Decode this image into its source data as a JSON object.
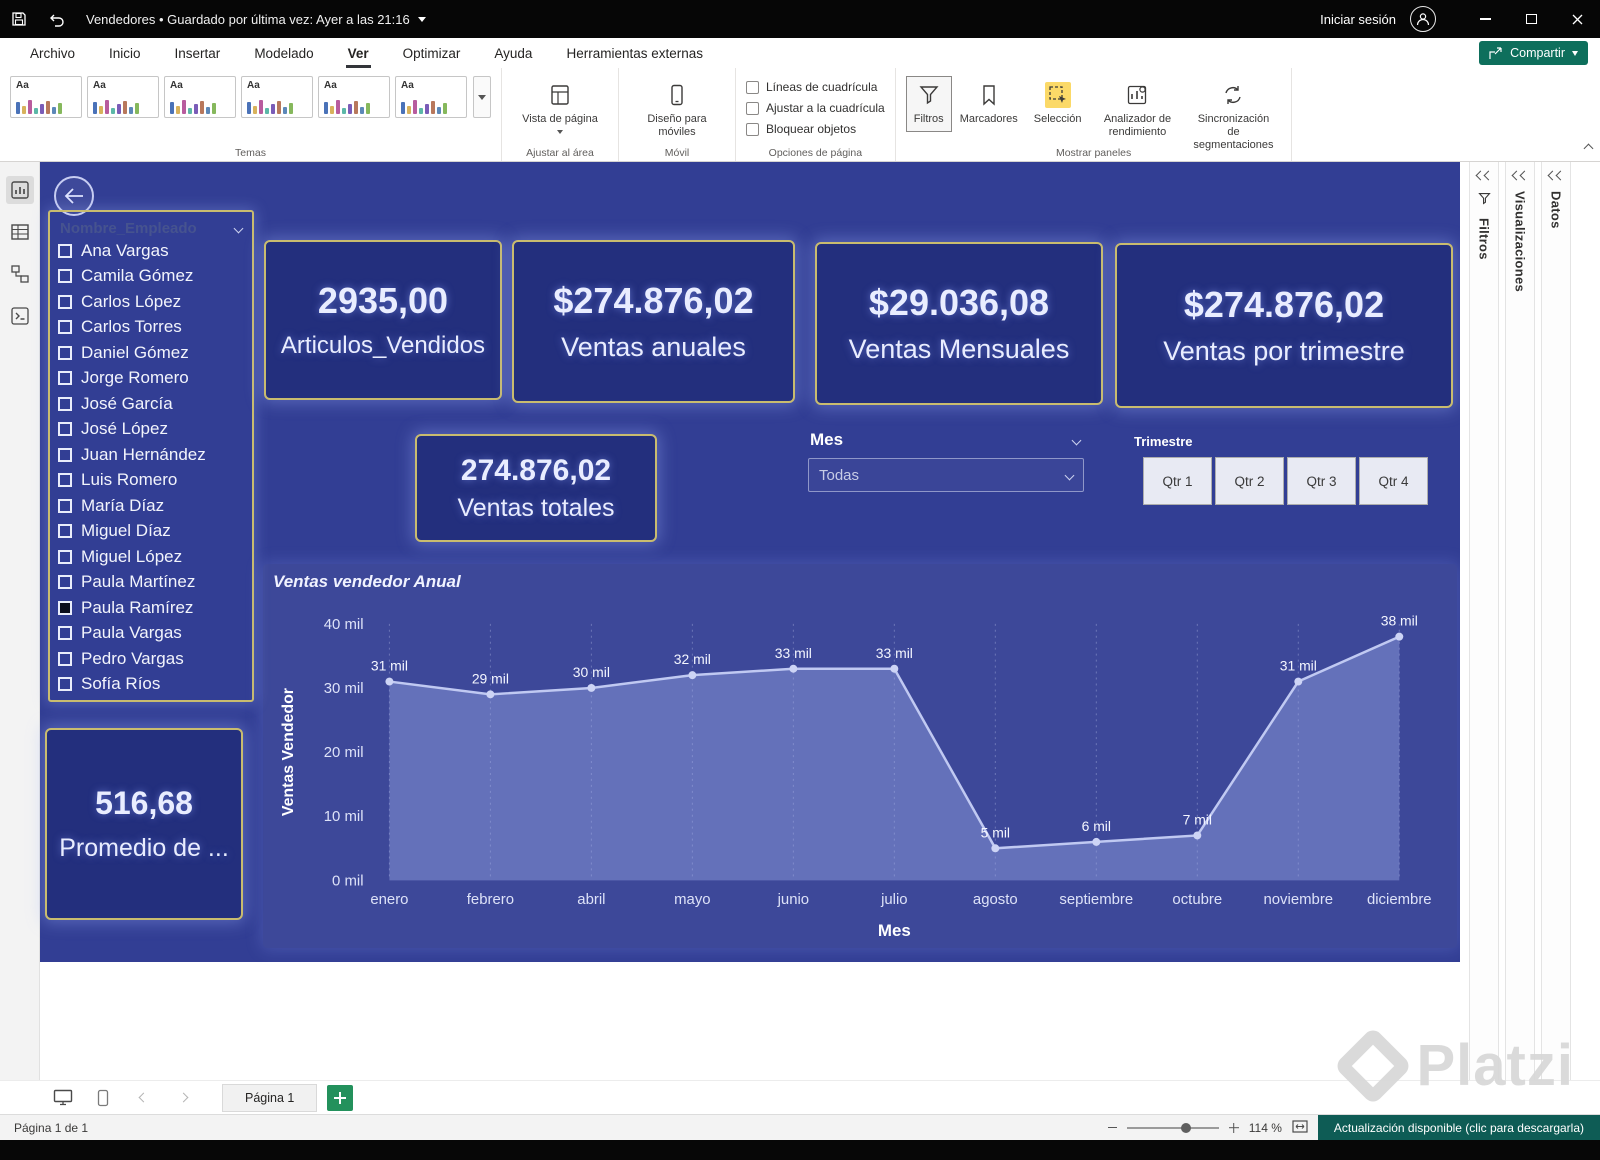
{
  "titlebar": {
    "title": "Vendedores • Guardado por última vez: Ayer a las 21:16",
    "sign_in": "Iniciar sesión"
  },
  "menubar": {
    "items": [
      "Archivo",
      "Inicio",
      "Insertar",
      "Modelado",
      "Ver",
      "Optimizar",
      "Ayuda",
      "Herramientas externas"
    ],
    "active": "Ver",
    "share_label": "Compartir"
  },
  "ribbon": {
    "themes": {
      "group_label": "Temas",
      "items": [
        {
          "label": "Aa"
        },
        {
          "label": "Aa"
        },
        {
          "label": "Aa"
        },
        {
          "label": "Aa"
        },
        {
          "label": "Aa"
        },
        {
          "label": "Aa"
        }
      ]
    },
    "page_view": {
      "label": "Vista de página",
      "group_label": "Ajustar al área"
    },
    "mobile": {
      "label": "Diseño para móviles",
      "group_label": "Móvil"
    },
    "page_options": {
      "group_label": "Opciones de página",
      "options": [
        "Líneas de cuadrícula",
        "Ajustar a la cuadrícula",
        "Bloquear objetos"
      ]
    },
    "panels": {
      "group_label": "Mostrar paneles",
      "buttons": [
        "Filtros",
        "Marcadores",
        "Selección",
        "Analizador de rendimiento",
        "Sincronización de segmentaciones"
      ]
    }
  },
  "canvas": {
    "slicer": {
      "title": "Nombre_Empleado",
      "items": [
        {
          "label": "Ana Vargas",
          "checked": false
        },
        {
          "label": "Camila Gómez",
          "checked": false
        },
        {
          "label": "Carlos López",
          "checked": false
        },
        {
          "label": "Carlos Torres",
          "checked": false
        },
        {
          "label": "Daniel Gómez",
          "checked": false
        },
        {
          "label": "Jorge Romero",
          "checked": false
        },
        {
          "label": "José García",
          "checked": false
        },
        {
          "label": "José López",
          "checked": false
        },
        {
          "label": "Juan Hernández",
          "checked": false
        },
        {
          "label": "Luis Romero",
          "checked": false
        },
        {
          "label": "María Díaz",
          "checked": false
        },
        {
          "label": "Miguel Díaz",
          "checked": false
        },
        {
          "label": "Miguel López",
          "checked": false
        },
        {
          "label": "Paula Martínez",
          "checked": false
        },
        {
          "label": "Paula Ramírez",
          "checked": true
        },
        {
          "label": "Paula Vargas",
          "checked": false
        },
        {
          "label": "Pedro Vargas",
          "checked": false
        },
        {
          "label": "Sofía Ríos",
          "checked": false
        }
      ]
    },
    "cards": [
      {
        "value": "2935,00",
        "label": "Articulos_Vendidos"
      },
      {
        "value": "$274.876,02",
        "label": "Ventas anuales"
      },
      {
        "value": "$29.036,08",
        "label": "Ventas Mensuales"
      },
      {
        "value": "$274.876,02",
        "label": "Ventas por trimestre"
      }
    ],
    "totals_card": {
      "value": "274.876,02",
      "label": "Ventas totales"
    },
    "promedio_card": {
      "value": "516,68",
      "label": "Promedio de ..."
    },
    "mes_slicer": {
      "title": "Mes",
      "value": "Todas"
    },
    "trimestre_slicer": {
      "title": "Trimestre",
      "buttons": [
        "Qtr 1",
        "Qtr 2",
        "Qtr 3",
        "Qtr 4"
      ]
    }
  },
  "chart_data": {
    "type": "line",
    "title": "Ventas vendedor Anual",
    "categories": [
      "enero",
      "febrero",
      "abril",
      "mayo",
      "junio",
      "julio",
      "agosto",
      "septiembre",
      "octubre",
      "noviembre",
      "diciembre"
    ],
    "values": [
      31,
      29,
      30,
      32,
      33,
      33,
      5,
      6,
      7,
      31,
      38
    ],
    "data_labels": [
      "31 mil",
      "29 mil",
      "30 mil",
      "32 mil",
      "33 mil",
      "33 mil",
      "5 mil",
      "6 mil",
      "7 mil",
      "31 mil",
      "38 mil"
    ],
    "xlabel": "Mes",
    "ylabel": "Ventas Vendedor",
    "ylim": [
      0,
      40
    ],
    "yticks": [
      0,
      10,
      20,
      30,
      40
    ],
    "ytick_labels": [
      "0 mil",
      "10 mil",
      "20 mil",
      "30 mil",
      "40 mil"
    ],
    "area": true,
    "grid": "vertical-dashed",
    "legend": "none",
    "line_color": "#c0c9f2",
    "fill_color": "rgba(160,175,235,0.40)"
  },
  "side_panels": {
    "filters": "Filtros",
    "visualizations": "Visualizaciones",
    "data": "Datos"
  },
  "bottom": {
    "page_tab": "Página 1",
    "status_left": "Página 1 de 1",
    "zoom": "114 %",
    "update_text": "Actualización disponible (clic para descargarla)"
  },
  "watermark": "Platzi",
  "colors": {
    "accent_teal": "#0e6f5c",
    "canvas_bg": "#323e94",
    "card_bg": "#232f7d",
    "card_border": "#c9bc6f",
    "selection_highlight": "#fbd968",
    "add_page_green": "#23915c",
    "update_chip": "#0e5c55"
  }
}
